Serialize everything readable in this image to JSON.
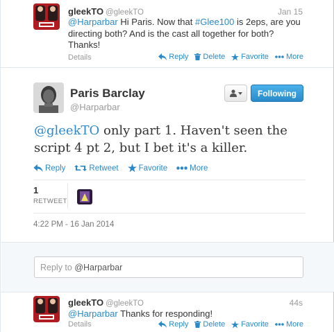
{
  "top_tweet": {
    "name": "gleekTO",
    "handle": "@gleekTO",
    "time": "Jan 15",
    "mention": "@Harparbar",
    "text_1": " Hi Paris. Now that ",
    "hashtag": "#Glee100",
    "text_2": " is 2eps, are you directing both? And is the cast all together for both? Thanks!",
    "details_label": "Details",
    "actions": {
      "reply": "Reply",
      "delete": "Delete",
      "favorite": "Favorite",
      "more": "More"
    }
  },
  "main_tweet": {
    "name": "Paris Barclay",
    "handle": "@Harparbar",
    "follow_label": "Following",
    "mention": "@gleekTO",
    "text": " only part 1. Haven't seen the script 4 pt 2, but I bet it's a killer.",
    "actions": {
      "reply": "Reply",
      "retweet": "Retweet",
      "favorite": "Favorite",
      "more": "More"
    },
    "retweet_count": "1",
    "retweet_label": "RETWEET",
    "timestamp": "4:22 PM - 16 Jan 2014",
    "reply_prefix": "Reply to ",
    "reply_handle": "@Harparbar"
  },
  "bottom_tweet": {
    "name": "gleekTO",
    "handle": "@gleekTO",
    "time": "44s",
    "mention": "@Harparbar",
    "text": " Thanks for responding!",
    "details_label": "Details",
    "actions": {
      "reply": "Reply",
      "delete": "Delete",
      "favorite": "Favorite",
      "more": "More"
    }
  },
  "colors": {
    "link": "#2a8ac9",
    "follow_button": "#2a8ac9",
    "muted": "#999999"
  }
}
